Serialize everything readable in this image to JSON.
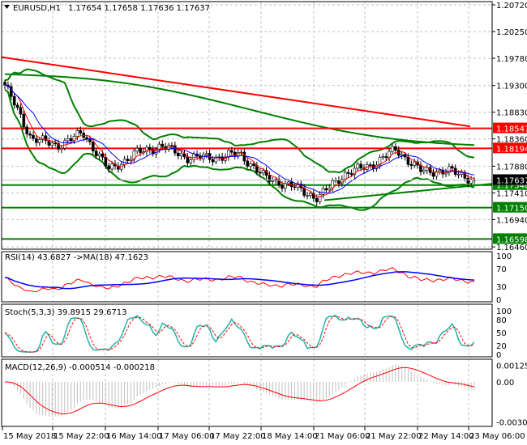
{
  "header": {
    "symbol": "EURUSD,H1",
    "ohlc": "1.17654 1.17658 1.17636 1.17637"
  },
  "indicators": {
    "rsi": "RSI(14) 43.6827  ->MA(18) 47.1623",
    "stoch": "Stoch(5,3,3) 39.8915 29.6713",
    "macd": "MACD(12,26,9) -0.000514 -0.000218"
  },
  "colors": {
    "bull": "#000000",
    "bear": "#000000",
    "ma_fast": "#ff0000",
    "ma_slow": "#0000ff",
    "bands": "#008000",
    "red_line": "#ff0000",
    "green_line": "#008000",
    "stoch_main": "#20b2aa",
    "stoch_signal": "#ff0000",
    "macd_hist": "#c0c0c0"
  },
  "chart_data": {
    "type": "candlestick",
    "price_ticks": [
      "1.20720",
      "1.20250",
      "1.19780",
      "1.19300",
      "1.18830",
      "1.18360",
      "1.17880",
      "1.17410",
      "1.16940",
      "1.16460"
    ],
    "price_range": [
      1.1646,
      1.2072
    ],
    "current_price": "1.17637",
    "levels": [
      {
        "label": "1.18547",
        "value": 1.18547,
        "color": "#ff0000"
      },
      {
        "label": "1.18194",
        "value": 1.18194,
        "color": "#ff0000"
      },
      {
        "label": "1.17548",
        "value": 1.17548,
        "color": "#008000"
      },
      {
        "label": "1.17150",
        "value": 1.1715,
        "color": "#008000"
      },
      {
        "label": "1.16598",
        "value": 1.16598,
        "color": "#008000"
      }
    ],
    "close_anchors": [
      1.1931,
      1.1838,
      1.1824,
      1.1846,
      1.1781,
      1.181,
      1.1824,
      1.1803,
      1.1803,
      1.181,
      1.1767,
      1.1753,
      1.1732,
      1.1774,
      1.1789,
      1.1817,
      1.1778,
      1.178,
      1.1764
    ],
    "long_ma_red": [
      1.198,
      1.1858
    ],
    "long_ma_green": [
      1.195,
      1.183
    ],
    "trendline": [
      1.1728,
      1.1757
    ],
    "time_labels": [
      "15 May 2018",
      "15 May 22:00",
      "16 May 14:00",
      "17 May 06:00",
      "17 May 22:00",
      "18 May 14:00",
      "21 May 06:00",
      "21 May 22:00",
      "22 May 14:00",
      "23 May 06:00"
    ],
    "rsi_ticks": [
      "100",
      "70",
      "30",
      "0"
    ],
    "stoch_ticks": [
      "100",
      "80",
      "50",
      "20",
      "0"
    ],
    "macd_ticks": [
      "0.00125",
      "0.00",
      "-0.003054"
    ]
  }
}
